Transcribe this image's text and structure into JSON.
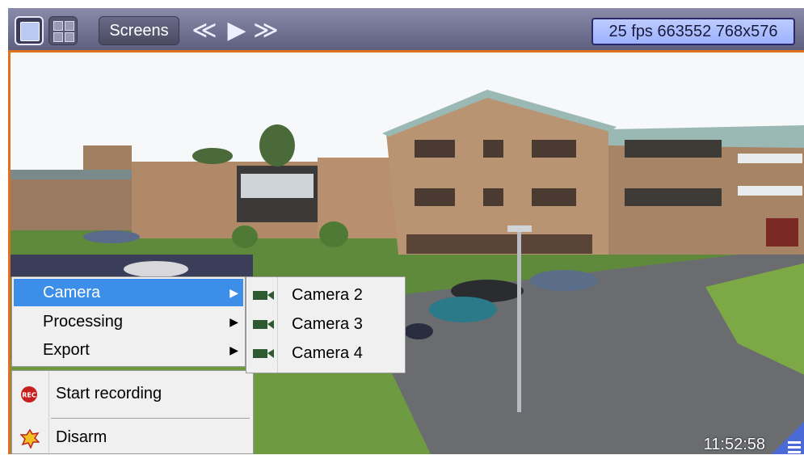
{
  "toolbar": {
    "screens_label": "Screens",
    "nav": {
      "prev_glyph": "≪",
      "play_glyph": "▶",
      "next_glyph": "≫"
    },
    "status": "25 fps 663552 768x576"
  },
  "camera_view": {
    "timestamp": "11:52:58"
  },
  "context_menu": {
    "items": [
      {
        "label": "Camera",
        "submenu": true
      },
      {
        "label": "Processing",
        "submenu": true
      },
      {
        "label": "Export",
        "submenu": true
      }
    ],
    "actions": [
      {
        "label": "Start recording",
        "icon": "rec-icon"
      },
      {
        "label": "Disarm",
        "icon": "disarm-icon"
      }
    ]
  },
  "camera_submenu": {
    "items": [
      {
        "label": "Camera 2",
        "icon": "camera-icon"
      },
      {
        "label": "Camera 3",
        "icon": "camera-icon"
      },
      {
        "label": "Camera 4",
        "icon": "camera-icon"
      }
    ]
  },
  "colors": {
    "accent_orange": "#e07020",
    "toolbar": "#6e6e8e",
    "menu_highlight": "#3d8ee8",
    "status_box": "#a8bbff"
  }
}
